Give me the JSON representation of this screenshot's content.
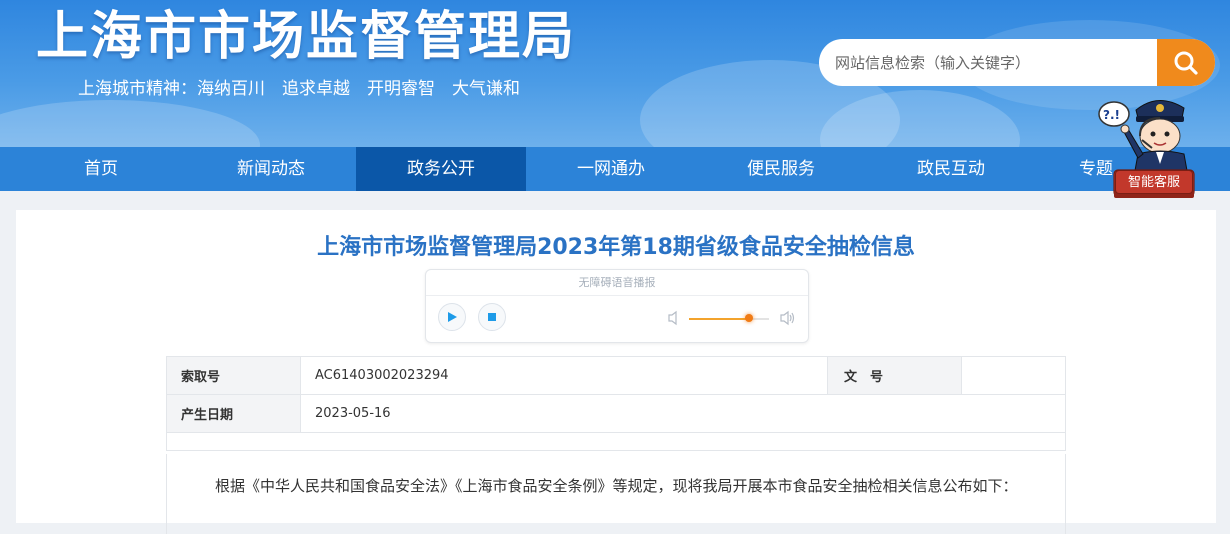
{
  "header": {
    "site_title": "上海市市场监督管理局",
    "city_spirit": "上海城市精神：海纳百川　追求卓越　开明睿智　大气谦和"
  },
  "search": {
    "placeholder": "网站信息检索（输入关键字）",
    "icon": "search-icon"
  },
  "nav": {
    "items": [
      {
        "label": "首页"
      },
      {
        "label": "新闻动态"
      },
      {
        "label": "政务公开",
        "active": true
      },
      {
        "label": "一网通办"
      },
      {
        "label": "便民服务"
      },
      {
        "label": "政民互动"
      },
      {
        "label": "专题"
      }
    ]
  },
  "customer_service": {
    "label": "智能客服",
    "bubble": "?.!"
  },
  "article": {
    "title": "上海市市场监督管理局2023年第18期省级食品安全抽检信息"
  },
  "audio_player": {
    "label": "无障碍语音播报",
    "volume_percent": 75
  },
  "info": {
    "index_label": "索取号",
    "index_value": "AC61403002023294",
    "doc_no_label": "文　号",
    "doc_no_value": "",
    "date_label": "产生日期",
    "date_value": "2023-05-16"
  },
  "body": {
    "paragraph": "根据《中华人民共和国食品安全法》《上海市食品安全条例》等规定，现将我局开展本市食品安全抽检相关信息公布如下："
  },
  "colors": {
    "header_blue": "#2f86df",
    "nav_blue": "#2c83d8",
    "nav_active": "#0b57a8",
    "search_orange": "#f08a1c",
    "title_blue": "#2a72c4"
  }
}
